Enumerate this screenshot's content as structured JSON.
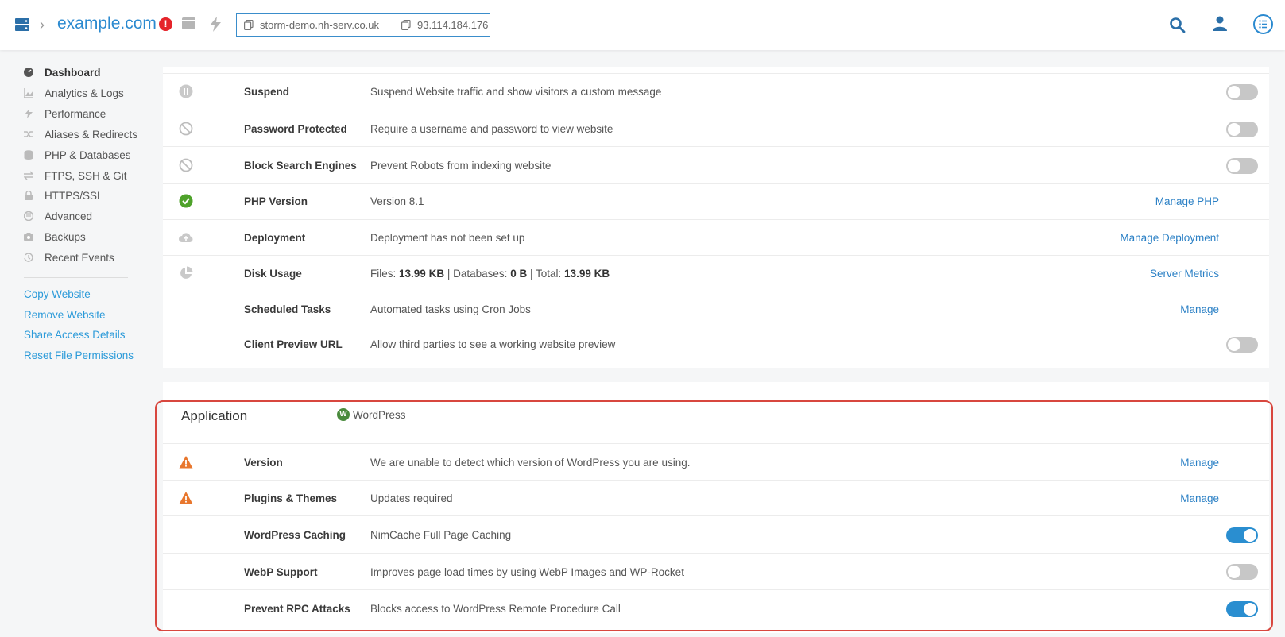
{
  "header": {
    "domain": "example.com",
    "alert_count": "!",
    "hostname": "storm-demo.nh-serv.co.uk",
    "ip": "93.114.184.176"
  },
  "sidebar": {
    "items": [
      {
        "label": "Dashboard",
        "icon": "dashboard-icon"
      },
      {
        "label": "Analytics & Logs",
        "icon": "chart-icon"
      },
      {
        "label": "Performance",
        "icon": "bolt-icon"
      },
      {
        "label": "Aliases & Redirects",
        "icon": "shuffle-icon"
      },
      {
        "label": "PHP & Databases",
        "icon": "database-icon"
      },
      {
        "label": "FTPS, SSH & Git",
        "icon": "transfer-icon"
      },
      {
        "label": "HTTPS/SSL",
        "icon": "lock-icon"
      },
      {
        "label": "Advanced",
        "icon": "advanced-icon"
      },
      {
        "label": "Backups",
        "icon": "camera-icon"
      },
      {
        "label": "Recent Events",
        "icon": "history-icon"
      }
    ],
    "links": [
      "Copy Website",
      "Remove Website",
      "Share Access Details",
      "Reset File Permissions"
    ]
  },
  "settings": [
    {
      "name": "Suspend",
      "desc": "Suspend Website traffic and show visitors a custom message",
      "icon": "pause-icon",
      "toggle_on": false
    },
    {
      "name": "Password Protected",
      "desc": "Require a username and password to view website",
      "icon": "block-icon",
      "toggle_on": false
    },
    {
      "name": "Block Search Engines",
      "desc": "Prevent Robots from indexing website",
      "icon": "block-icon",
      "toggle_on": false
    },
    {
      "name": "PHP Version",
      "desc": "Version 8.1",
      "icon": "check-icon",
      "action": "Manage PHP"
    },
    {
      "name": "Deployment",
      "desc": "Deployment has not been set up",
      "icon": "cloud-upload-icon",
      "action": "Manage Deployment"
    },
    {
      "name": "Disk Usage",
      "icon": "pie-icon",
      "action": "Server Metrics",
      "disk": {
        "files_label": "Files:",
        "files": "13.99 KB",
        "sep1": "|",
        "db_label": "Databases:",
        "db": "0 B",
        "sep2": "|",
        "total_label": "Total:",
        "total": "13.99 KB"
      }
    },
    {
      "name": "Scheduled Tasks",
      "desc": "Automated tasks using Cron Jobs",
      "action": "Manage"
    },
    {
      "name": "Client Preview URL",
      "desc": "Allow third parties to see a working website preview",
      "toggle_on": false
    }
  ],
  "application": {
    "title": "Application",
    "platform": "WordPress",
    "rows": [
      {
        "name": "Version",
        "desc": "We are unable to detect which version of WordPress you are using.",
        "icon": "warning-icon",
        "action": "Manage"
      },
      {
        "name": "Plugins & Themes",
        "desc": "Updates required",
        "icon": "warning-icon",
        "action": "Manage"
      },
      {
        "name": "WordPress Caching",
        "desc": "NimCache Full Page Caching",
        "toggle_on": true
      },
      {
        "name": "WebP Support",
        "desc": "Improves page load times by using WebP Images and WP-Rocket",
        "toggle_on": false
      },
      {
        "name": "Prevent RPC Attacks",
        "desc": "Blocks access to WordPress Remote Procedure Call",
        "toggle_on": true
      }
    ]
  },
  "colors": {
    "accent": "#2b8ad0",
    "toggle_on": "#2a8ed0",
    "toggle_off": "#c7c7c7",
    "warning": "#e8772e",
    "success": "#4ea22a",
    "alert": "#e5242a",
    "highlight_frame": "#d8473f"
  }
}
